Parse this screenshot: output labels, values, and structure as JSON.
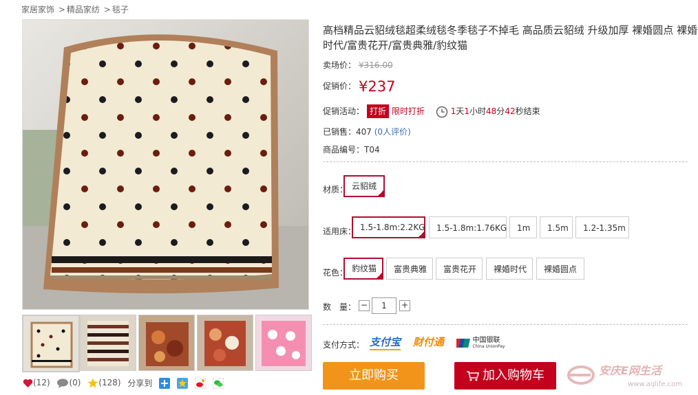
{
  "breadcrumb": {
    "items": [
      "家居家饰",
      "精品家纺",
      "毯子"
    ],
    "separator": ">"
  },
  "product": {
    "title": "高档精品云貂绒毯超柔绒毯冬季毯子不掉毛 高品质云貂绒 升级加厚 裸婚圆点 裸婚时代/富贵花开/富贵典雅/豹纹猫",
    "market_price_label": "卖场价：",
    "market_price": "¥316.00",
    "promo_price_label": "促销价：",
    "promo_price": "¥237",
    "promo_activity_label": "促销活动：",
    "promo_tag": "打折",
    "promo_name": "限时打折",
    "countdown": {
      "d": "1",
      "d_unit": "天",
      "h": "1",
      "h_unit": "小时",
      "m": "48",
      "m_unit": "分",
      "s": "42",
      "s_unit": "秒结束"
    },
    "sold_label": "已销售：",
    "sold_count": "407",
    "reviews": "(0人评价)",
    "sku_label": "商品编号：",
    "sku": "T04"
  },
  "options": {
    "material": {
      "label": "材质：",
      "values": [
        "云貂绒"
      ],
      "selected": 0
    },
    "bed": {
      "label": "适用床：",
      "values": [
        "1.5-1.8m:2.2KG",
        "1.5-1.8m:1.76KG",
        "1m",
        "1.5m",
        "1.2-1.35m"
      ],
      "selected": 0
    },
    "color": {
      "label": "花色：",
      "values": [
        "豹纹猫",
        "富贵典雅",
        "富贵花开",
        "裸婚时代",
        "裸婚圆点"
      ],
      "selected": 0
    },
    "quantity": {
      "label": "数　量：",
      "value": "1",
      "minus": "−",
      "plus": "+"
    }
  },
  "payment": {
    "label": "支付方式：",
    "methods": [
      "支付宝",
      "财付通",
      "中国银联"
    ],
    "unionpay_en": "China UnionPay"
  },
  "actions": {
    "buy_now": "立即购买",
    "add_to_cart": "加入购物车"
  },
  "social": {
    "likes": "(12)",
    "comments": "(0)",
    "stars": "(128)",
    "share_label": "分享到"
  },
  "watermark": {
    "text": "安庆E网生活",
    "url": "www.aqlife.com"
  },
  "colors": {
    "accent": "#c4001c",
    "buy_button": "#f19419",
    "cart_button": "#c4001c",
    "link": "#3a6fb0"
  }
}
